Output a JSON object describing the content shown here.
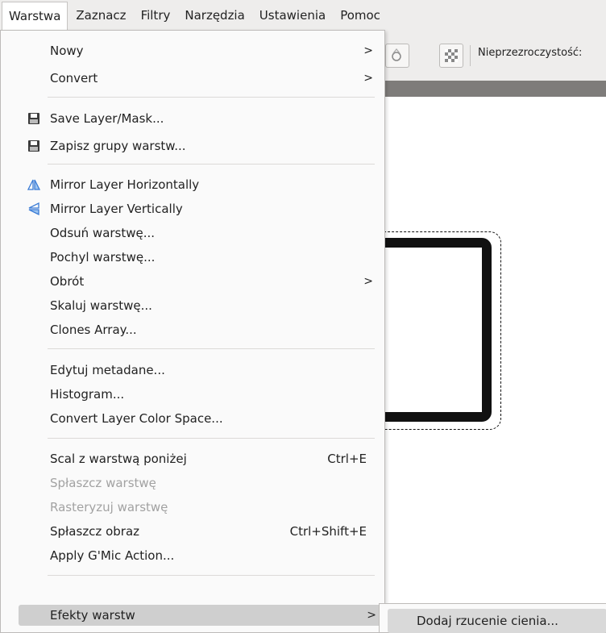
{
  "menubar": {
    "items": [
      {
        "label": "Warstwa",
        "active": true
      },
      {
        "label": "Zaznacz"
      },
      {
        "label": "Filtry"
      },
      {
        "label": "Narzędzia"
      },
      {
        "label": "Ustawienia"
      },
      {
        "label": "Pomoc"
      }
    ]
  },
  "toolbar": {
    "opacity_label": "Nieprzezroczystość:"
  },
  "layer_menu": {
    "items": [
      {
        "label": "Nowy",
        "submenu": true
      },
      {
        "label": "Convert",
        "submenu": true
      },
      {
        "label": "Save Layer/Mask...",
        "icon": "save-icon"
      },
      {
        "label": "Zapisz grupy warstw...",
        "icon": "save-icon"
      },
      {
        "label": "Mirror Layer Horizontally",
        "icon": "mirror-horizontal-icon"
      },
      {
        "label": "Mirror Layer Vertically",
        "icon": "mirror-vertical-icon"
      },
      {
        "label": "Odsuń warstwę..."
      },
      {
        "label": "Pochyl warstwę..."
      },
      {
        "label": "Obrót",
        "submenu": true
      },
      {
        "label": "Skaluj warstwę..."
      },
      {
        "label": "Clones Array..."
      },
      {
        "label": "Edytuj metadane..."
      },
      {
        "label": "Histogram..."
      },
      {
        "label": "Convert Layer Color Space..."
      },
      {
        "label": "Scal z warstwą poniżej",
        "shortcut": "Ctrl+E"
      },
      {
        "label": "Spłaszcz warstwę",
        "disabled": true
      },
      {
        "label": "Rasteryzuj warstwę",
        "disabled": true
      },
      {
        "label": "Spłaszcz obraz",
        "shortcut": "Ctrl+Shift+E"
      },
      {
        "label": "Apply G'Mic Action..."
      },
      {
        "label": "Efekty warstw",
        "submenu": true,
        "highlighted": true
      }
    ],
    "submenu_arrow": ">"
  },
  "effects_submenu": {
    "items": [
      {
        "label": "Dodaj rzucenie cienia..."
      }
    ]
  },
  "colors": {
    "menubar_bg": "#eeedec",
    "menu_bg": "#fafafa",
    "highlight_bg": "#cfcfcf",
    "disabled_text": "#a2a2a2"
  }
}
